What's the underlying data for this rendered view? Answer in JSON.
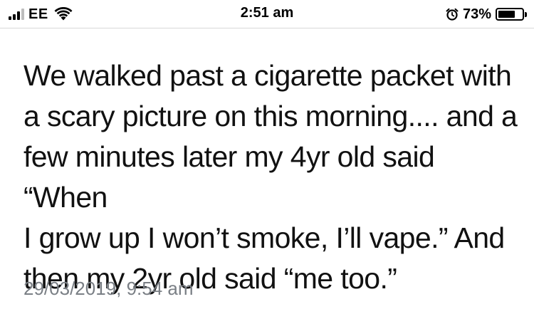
{
  "status_bar": {
    "carrier": "EE",
    "time": "2:51 am",
    "battery_percent": "73%",
    "battery_level": 0.73,
    "icons": [
      "cellular-signal-icon",
      "wifi-icon",
      "alarm-icon",
      "battery-icon"
    ]
  },
  "tweet": {
    "text": "We walked past a cigarette packet with a scary picture on this morning.... and a few minutes later my 4yr old said “When I grow up I won’t smoke, I’ll vape.” And then my 2yr old said “me too.”",
    "lines": [
      "We walked past a cigarette packet with",
      "a scary picture on this morning.... and a",
      "few minutes later my 4yr old said “When",
      "I grow up I won’t smoke, I’ll vape.” And",
      "then my 2yr old said “me too.”"
    ],
    "timestamp": "29/03/2019, 9:54 am"
  },
  "colors": {
    "text": "#111111",
    "timestamp": "#7a7f85",
    "divider": "#d9d9d9"
  }
}
